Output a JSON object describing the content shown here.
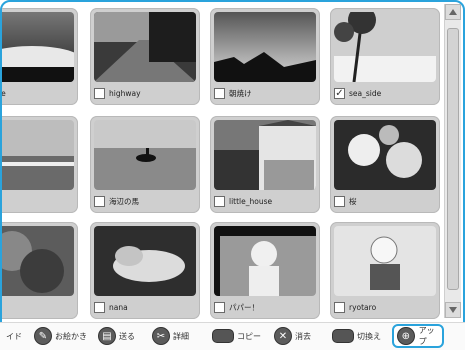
{
  "tiles": [
    {
      "label": "nane",
      "checked": false
    },
    {
      "label": "highway",
      "checked": false
    },
    {
      "label": "朝焼け",
      "checked": false
    },
    {
      "label": "sea_side",
      "checked": true
    },
    {
      "label": "",
      "checked": false
    },
    {
      "label": "海辺の馬",
      "checked": false
    },
    {
      "label": "little_house",
      "checked": false
    },
    {
      "label": "桜",
      "checked": false
    },
    {
      "label": "nd",
      "checked": false
    },
    {
      "label": "nana",
      "checked": false
    },
    {
      "label": "パパー！",
      "checked": false
    },
    {
      "label": "ryotaro",
      "checked": false
    }
  ],
  "toolbar": {
    "slide_label": "イド",
    "recommend_label": "お絵かき",
    "send_label": "送る",
    "detail_label": "詳細",
    "copy_label": "コピー",
    "delete_label": "消去",
    "switch_label": "切換え",
    "up_label": "アップ"
  },
  "colors": {
    "accent": "#2aa3dc"
  }
}
